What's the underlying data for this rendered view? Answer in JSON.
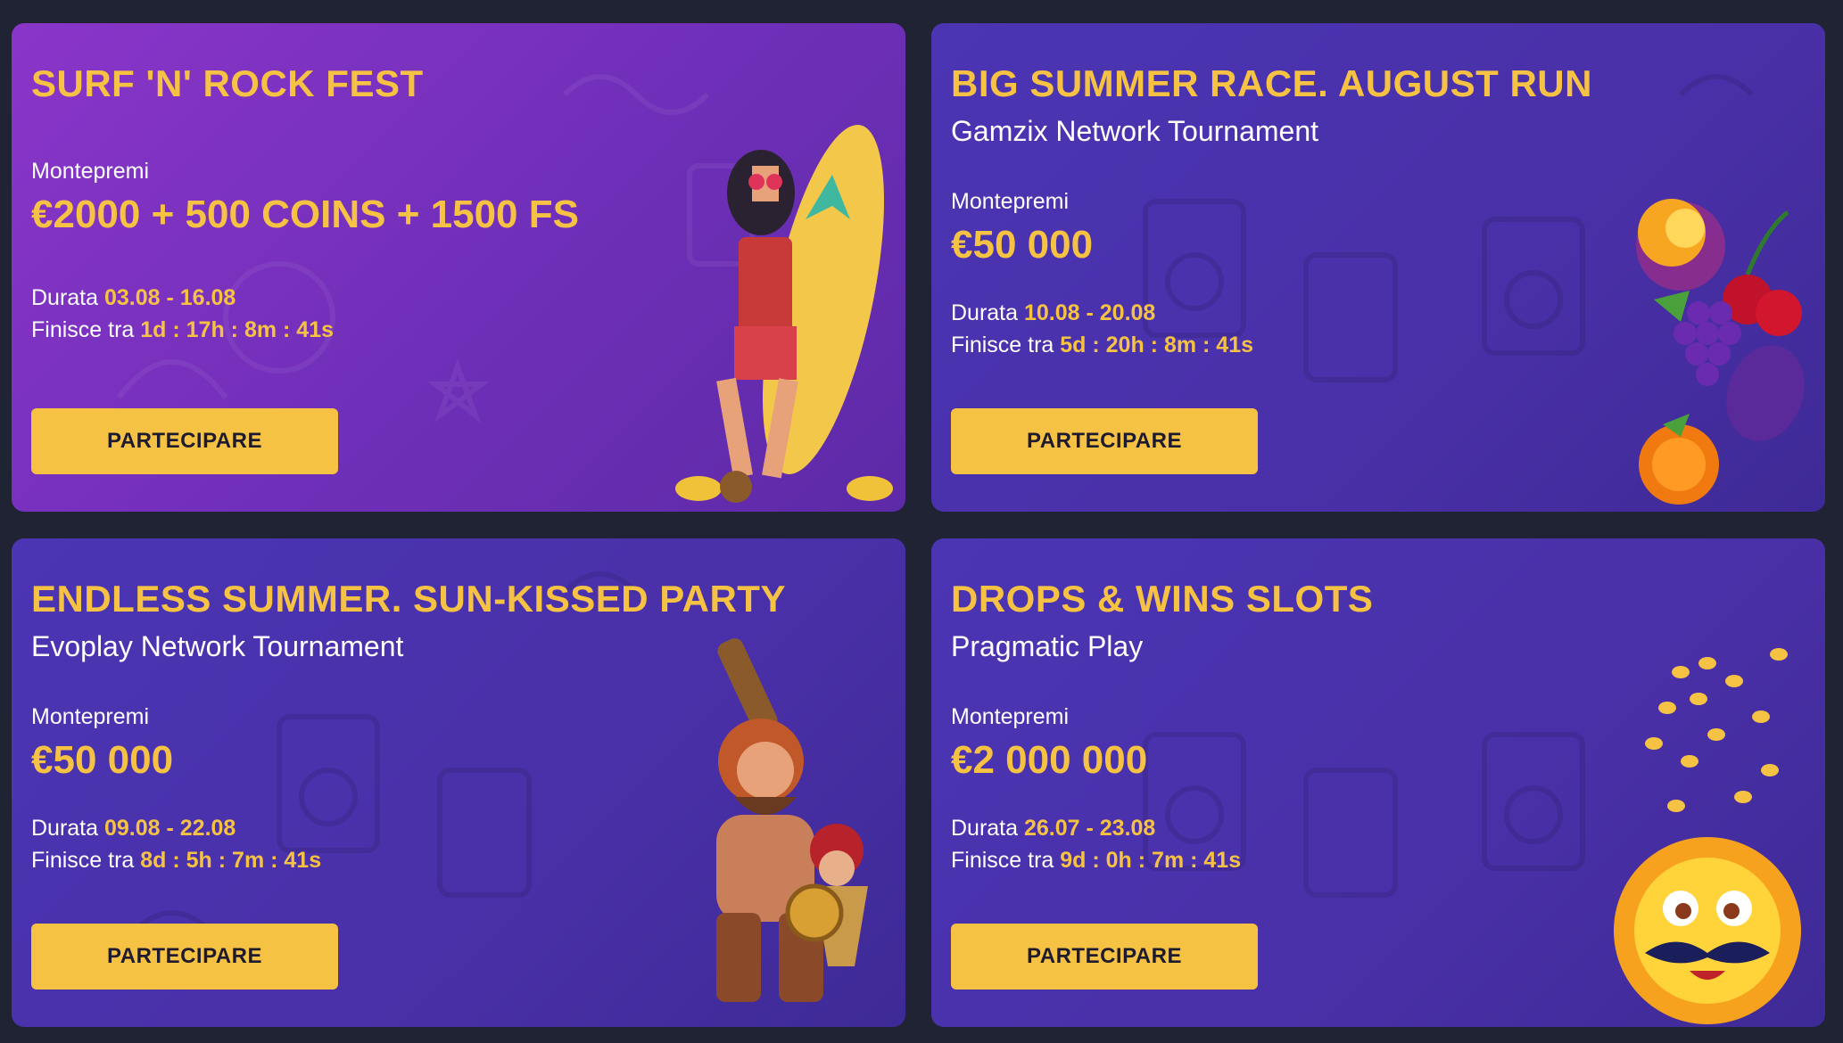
{
  "cards": [
    {
      "title": "SURF 'N' ROCK FEST",
      "subtitle": "",
      "prize_label": "Montepremi",
      "prize": "€2000 + 500 COINS + 1500 FS",
      "duration_label": "Durata",
      "duration": "03.08 - 16.08",
      "ends_label": "Finisce tra",
      "ends": "1d : 17h : 8m : 41s",
      "button": "PARTECIPARE",
      "art_icon": "rocker-surfboard-illustration"
    },
    {
      "title": "BIG SUMMER RACE. AUGUST RUN",
      "subtitle": "Gamzix Network Tournament",
      "prize_label": "Montepremi",
      "prize": "€50 000",
      "duration_label": "Durata",
      "duration": "10.08 - 20.08",
      "ends_label": "Finisce tra",
      "ends": "5d : 20h : 8m : 41s",
      "button": "PARTECIPARE",
      "art_icon": "fruits-illustration"
    },
    {
      "title": "ENDLESS SUMMER. SUN-KISSED PARTY",
      "subtitle": "Evoplay Network Tournament",
      "prize_label": "Montepremi",
      "prize": "€50 000",
      "duration_label": "Durata",
      "duration": "09.08 - 22.08",
      "ends_label": "Finisce tra",
      "ends": "8d : 5h : 7m : 41s",
      "button": "PARTECIPARE",
      "art_icon": "warriors-illustration"
    },
    {
      "title": "DROPS & WINS SLOTS",
      "subtitle": "Pragmatic Play",
      "prize_label": "Montepremi",
      "prize": "€2 000 000",
      "duration_label": "Durata",
      "duration": "26.07 - 23.08",
      "ends_label": "Finisce tra",
      "ends": "9d : 0h : 7m : 41s",
      "button": "PARTECIPARE",
      "art_icon": "sun-coins-illustration"
    }
  ],
  "colors": {
    "background": "#1f2333",
    "accent": "#f6c243",
    "card_purple": "#7a32bd",
    "card_indigo": "#4a30a8"
  }
}
